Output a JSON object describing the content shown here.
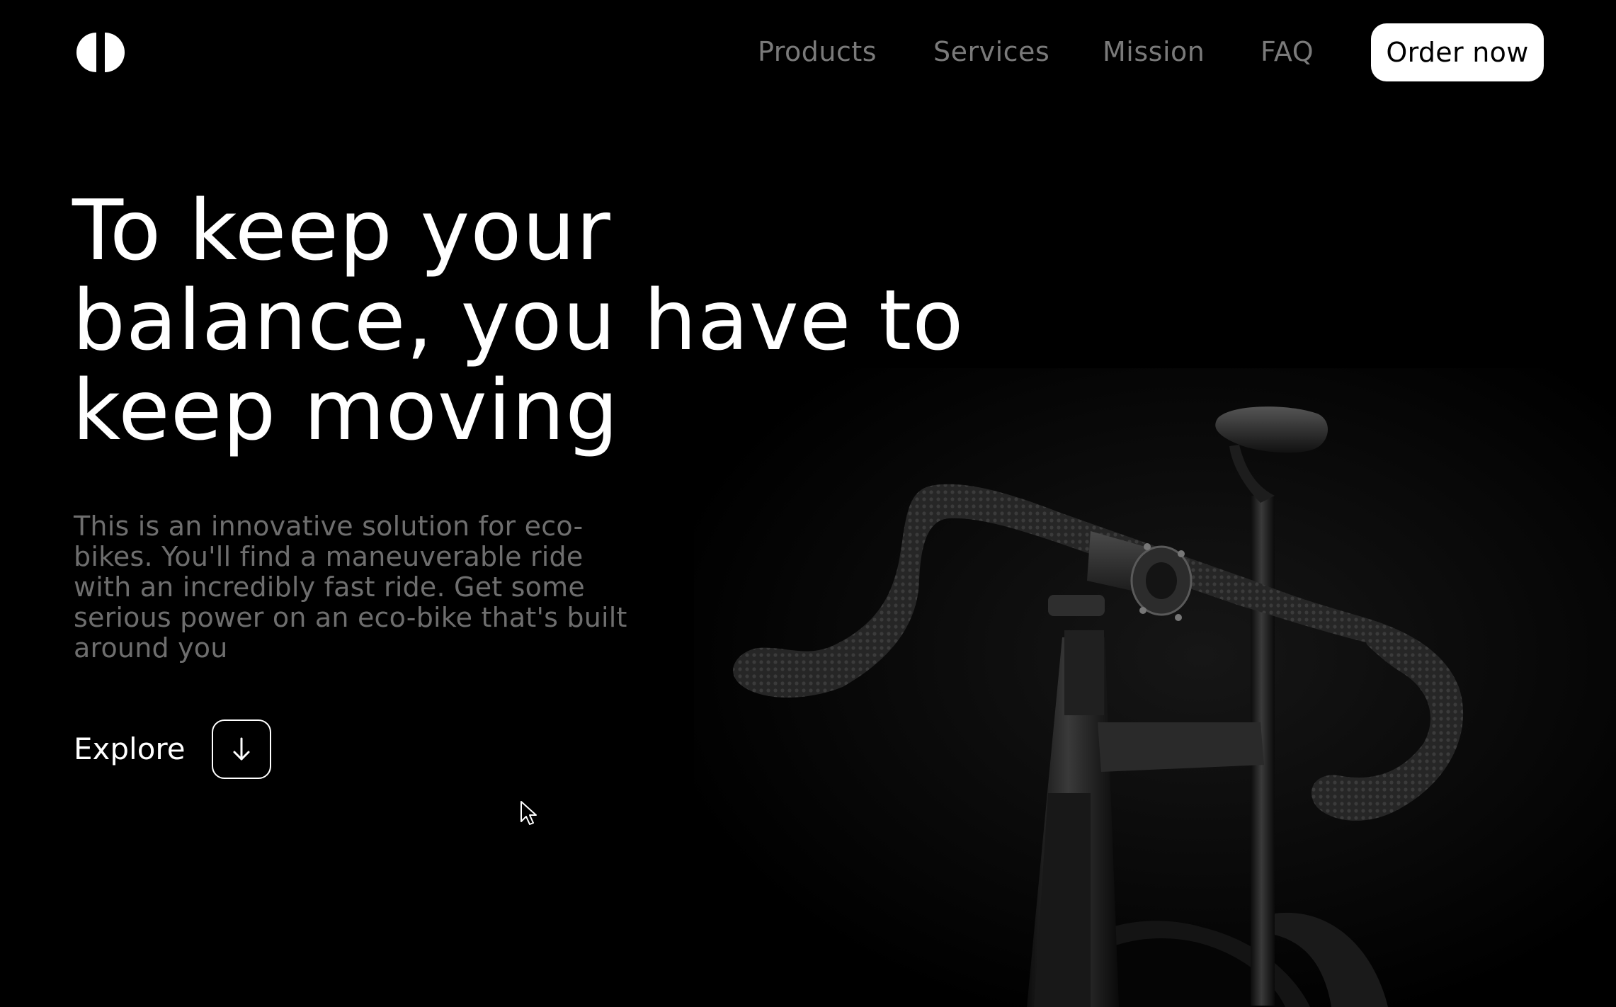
{
  "header": {
    "logo_icon": "half-moon-logo-icon",
    "nav": {
      "products": "Products",
      "services": "Services",
      "mission": "Mission",
      "faq": "FAQ"
    },
    "order_button": "Order now"
  },
  "hero": {
    "headline_lines": [
      "To keep your",
      "balance, you have to",
      "keep moving"
    ],
    "description": "This is an innovative solution for eco-bikes. You'll find a maneuverable ride with an incredibly fast ride. Get some serious power on an eco-bike that's built around you",
    "explore_label": "Explore",
    "explore_icon": "arrow-down-icon",
    "image_subject": "bicycle-handlebars-image"
  },
  "colors": {
    "background": "#000000",
    "text_primary": "#ffffff",
    "nav_text": "#7a7a7a",
    "description_text": "#6e6e6e",
    "button_bg": "#ffffff",
    "button_text": "#000000"
  }
}
